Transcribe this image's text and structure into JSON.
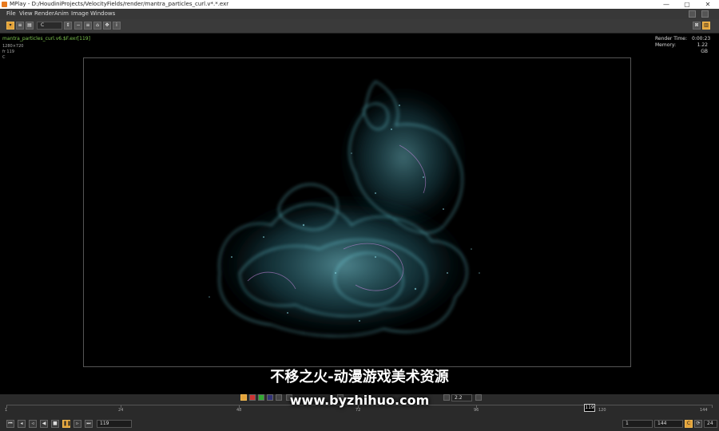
{
  "window": {
    "title": "MPlay - D:/HoudiniProjects/VelocityFields/render/mantra_particles_curl.v*.*.exr",
    "controls": {
      "minimize": "—",
      "maximize": "▢",
      "close": "✕"
    }
  },
  "menu": [
    "File",
    "View",
    "Render",
    "Anim",
    "Image",
    "Windows"
  ],
  "toolbar": {
    "channel_value": "C"
  },
  "viewer": {
    "image_name": "mantra_particles_curl.v6.$F.exr[119]",
    "resolution": "1280×720",
    "frame_info": "fr 119",
    "channel": "C",
    "render_time_label": "Render Time:",
    "render_time_value": "0:00:23",
    "memory_label": "Memory:",
    "memory_value": "1.22 GB"
  },
  "playbar": {
    "gamma_value": "2.2",
    "timeline_ticks": [
      "1",
      "24",
      "48",
      "72",
      "96",
      "120",
      "144"
    ],
    "current_frame": "119",
    "frame_field": "119",
    "start_frame": "1",
    "end_frame": "144",
    "fps": "24"
  },
  "watermark": {
    "line1": "不移之火-动漫游戏美术资源",
    "line2": "www.byzhihuo.com"
  },
  "colors": {
    "accent": "#e2a23a",
    "particle_cyan": "#6fe6f5",
    "particle_pink": "#d68ce0",
    "info_green": "#7ec850"
  }
}
